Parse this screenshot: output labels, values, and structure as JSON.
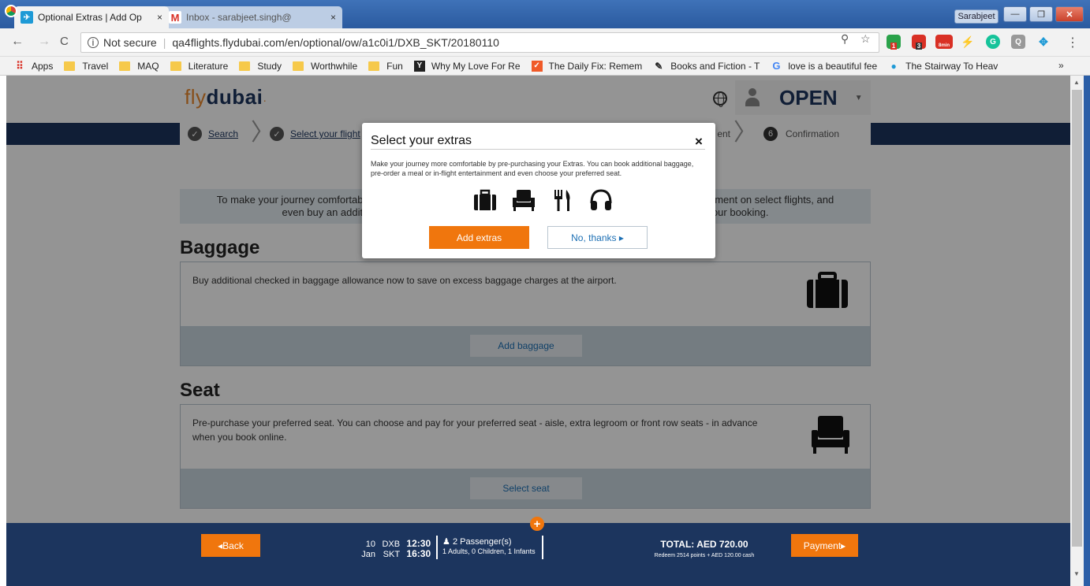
{
  "browser": {
    "tabs": [
      {
        "label": "Optional Extras | Add Op",
        "close": "×"
      },
      {
        "label": "Inbox - sarabjeet.singh@",
        "close": "×"
      }
    ],
    "profile": "Sarabjeet",
    "window_buttons": {
      "minimize": "—",
      "restore": "❐",
      "close": "✕"
    },
    "nav": {
      "back": "←",
      "forward": "→",
      "reload": "C"
    },
    "address": {
      "security": "Not secure",
      "url": "qa4flights.flydubai.com/en/optional/ow/a1c0i1/DXB_SKT/20180110"
    },
    "extension_badges": {
      "b1": "1",
      "b2": "3",
      "b3": "8min"
    },
    "bookmarks": [
      {
        "label": "Apps",
        "icon": "apps-grid-icon"
      },
      {
        "label": "Travel",
        "icon": "folder-icon"
      },
      {
        "label": "MAQ",
        "icon": "folder-icon"
      },
      {
        "label": "Literature",
        "icon": "folder-icon"
      },
      {
        "label": "Study",
        "icon": "folder-icon"
      },
      {
        "label": "Worthwhile",
        "icon": "folder-icon"
      },
      {
        "label": "Fun",
        "icon": "folder-icon"
      },
      {
        "label": "Why My Love For Re",
        "icon": "y-icon"
      },
      {
        "label": "The Daily Fix: Remem",
        "icon": "scroll-icon"
      },
      {
        "label": "Books and Fiction - T",
        "icon": "pin-icon"
      },
      {
        "label": "love is a beautiful fee",
        "icon": "google-icon"
      },
      {
        "label": "The Stairway To Heav",
        "icon": "location-icon"
      }
    ],
    "bookmarks_more": "»"
  },
  "site": {
    "logo_fly": "fly",
    "logo_dubai": "dubai",
    "login_label": "OPEN",
    "steps": [
      {
        "label": "Search",
        "state": "done"
      },
      {
        "label": "Select your flight",
        "state": "done"
      },
      {
        "label": "ent",
        "state": "hidden"
      },
      {
        "label": "Confirmation",
        "number": "6"
      }
    ],
    "intro_line1": "To make your journey comfortable, y                                                                                                               tainment on select flights, and",
    "intro_line2": "even buy an additiona                                                                                                               o your booking.",
    "baggage": {
      "title": "Baggage",
      "desc": "Buy additional checked in baggage allowance now to save on excess baggage charges at the airport.",
      "cta": "Add baggage"
    },
    "seat": {
      "title": "Seat",
      "desc": "Pre-purchase your preferred seat. You can choose and pay for your preferred seat - aisle, extra legroom or front row seats - in advance when you book online.",
      "cta": "Select seat"
    }
  },
  "modal": {
    "title": "Select your extras",
    "close": "×",
    "text": "Make your journey more comfortable by pre-purchasing your Extras. You can book additional baggage, pre-order a meal or in-flight entertainment and even choose your preferred seat.",
    "icons": [
      "baggage-icon",
      "seat-icon",
      "meal-icon",
      "headphones-icon"
    ],
    "add_label": "Add extras",
    "no_label": "No, thanks ▸"
  },
  "summary": {
    "back_label": "◂Back",
    "day": "10",
    "month": "Jan",
    "from_code": "DXB",
    "to_code": "SKT",
    "dep_time": "12:30",
    "arr_time": "16:30",
    "passengers": "2 Passenger(s)",
    "passenger_breakdown": "1 Adults, 0 Children, 1 Infants",
    "total": "TOTAL: AED 720.00",
    "redeem": "Redeem 2514 points + AED 120.00 cash",
    "payment_label": "Payment▸",
    "plus": "+"
  },
  "colors": {
    "brand_navy": "#1c355e",
    "brand_orange": "#f0760d",
    "link_blue": "#1c6fb4"
  }
}
